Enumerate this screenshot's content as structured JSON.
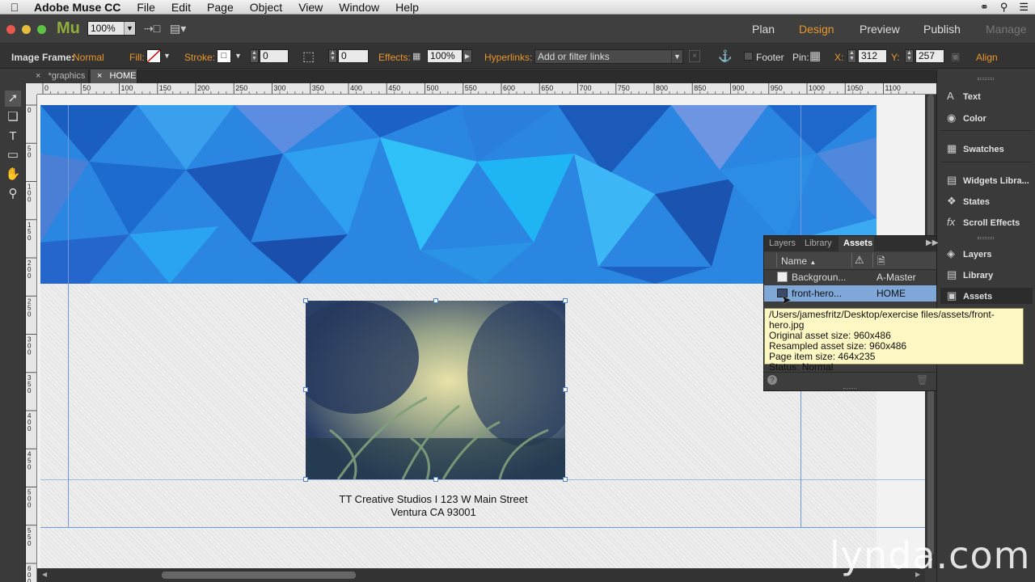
{
  "menubar": {
    "app_name": "Adobe Muse CC",
    "items": [
      "File",
      "Edit",
      "Page",
      "Object",
      "View",
      "Window",
      "Help"
    ]
  },
  "titlebar": {
    "logo": "Mu",
    "zoom": "100%",
    "modes": [
      "Plan",
      "Design",
      "Preview",
      "Publish",
      "Manage"
    ],
    "active_mode": "Design"
  },
  "controlbar": {
    "image_frame_label": "Image Frame:",
    "image_frame_value": "Normal",
    "fill_label": "Fill:",
    "stroke_label": "Stroke:",
    "stroke_width": "0",
    "corner_radius": "0",
    "effects_label": "Effects:",
    "opacity": "100%",
    "hyperlinks_label": "Hyperlinks:",
    "hyperlinks_placeholder": "Add or filter links",
    "footer_label": "Footer",
    "pin_label": "Pin:",
    "x_label": "X:",
    "x_value": "312",
    "y_label": "Y:",
    "y_value": "257",
    "align_label": "Align"
  },
  "tabs": [
    {
      "label": "*graphics",
      "close": "×"
    },
    {
      "label": "HOME",
      "close": "×"
    }
  ],
  "ruler": {
    "h_marks": [
      "0",
      "50",
      "100",
      "150",
      "200",
      "250",
      "300",
      "350",
      "400",
      "450",
      "500",
      "550",
      "600",
      "650",
      "700",
      "750",
      "800",
      "850",
      "900",
      "950",
      "1000",
      "1050",
      "1100"
    ],
    "v_marks": [
      "0",
      "50",
      "100",
      "150",
      "200",
      "250",
      "300",
      "350",
      "400",
      "450",
      "500",
      "550",
      "600"
    ]
  },
  "canvas": {
    "address_line1": "TT Creative Studios I 123 W Main Street",
    "address_line2": "Ventura CA 93001"
  },
  "right_panel": {
    "items": [
      {
        "label": "Text",
        "icon": "text-icon"
      },
      {
        "label": "Color",
        "icon": "color-icon"
      },
      {
        "label": "Swatches",
        "icon": "swatches-icon"
      },
      {
        "label": "Widgets Libra...",
        "icon": "widgets-icon"
      },
      {
        "label": "States",
        "icon": "states-icon"
      },
      {
        "label": "Scroll Effects",
        "icon": "scroll-effects-icon"
      },
      {
        "label": "Layers",
        "icon": "layers-icon"
      },
      {
        "label": "Library",
        "icon": "library-icon"
      },
      {
        "label": "Assets",
        "icon": "assets-icon"
      }
    ]
  },
  "assets_panel": {
    "tabs": [
      "Layers",
      "Library",
      "Assets"
    ],
    "active_tab": "Assets",
    "header_name": "Name",
    "rows": [
      {
        "name": "Backgroun...",
        "page": "A-Master"
      },
      {
        "name": "front-hero...",
        "page": "HOME"
      }
    ],
    "selected_row": 1
  },
  "tooltip": {
    "path": "/Users/jamesfritz/Desktop/exercise files/assets/front-hero.jpg",
    "original": "Original asset size: 960x486",
    "resampled": "Resampled asset size: 960x486",
    "page_item": "Page item size: 464x235",
    "status": "Status: Normal"
  },
  "watermark": "lynda.com",
  "colors": {
    "accent_orange": "#e8962a",
    "selection_blue": "#7fa7d8",
    "banner_blue": "#1f78d6",
    "tooltip_bg": "#fdf7c3"
  }
}
